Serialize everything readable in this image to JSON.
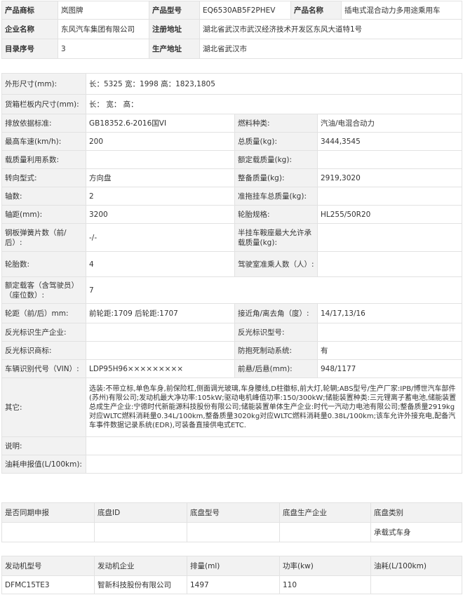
{
  "header": {
    "brand_label": "产品商标",
    "brand": "岚图牌",
    "model_label": "产品型号",
    "model": "EQ6530AB5F2PHEV",
    "name_label": "产品名称",
    "name": "插电式混合动力多用途乘用车",
    "company_label": "企业名称",
    "company": "东风汽车集团有限公司",
    "reg_addr_label": "注册地址",
    "reg_addr": "湖北省武汉市武汉经济技术开发区东风大道特1号",
    "catalog_label": "目录序号",
    "catalog": "3",
    "prod_addr_label": "生产地址",
    "prod_addr": "湖北省武汉市"
  },
  "specs": {
    "dims_label": "外形尺寸(mm):",
    "dims": "长：5325 宽：1998 高：1823,1805",
    "cargo_label": "货箱栏板内尺寸(mm):",
    "cargo": "长：  宽：  高：",
    "emission_label": "排放依据标准:",
    "emission": "GB18352.6-2016国VI",
    "fuel_label": "燃料种类:",
    "fuel": "汽油/电混合动力",
    "speed_label": "最高车速(km/h):",
    "speed": "200",
    "total_mass_label": "总质量(kg):",
    "total_mass": "3444,3545",
    "load_util_label": "载质量利用系数:",
    "load_util": "",
    "rated_load_label": "额定载质量(kg):",
    "rated_load": "",
    "steering_label": "转向型式:",
    "steering": "方向盘",
    "curb_label": "整备质量(kg):",
    "curb": "2919,3020",
    "axles_label": "轴数:",
    "axles": "2",
    "trailer_label": "准拖挂车总质量(kg):",
    "trailer": "",
    "wheelbase_label": "轴距(mm):",
    "wheelbase": "3200",
    "tire_label": "轮胎规格:",
    "tire": "HL255/50R20",
    "springs_label": "钢板弹簧片数（前/后）:",
    "springs": "-/-",
    "saddle_label": "半挂车鞍座最大允许承载质量(kg):",
    "saddle": "",
    "tires_num_label": "轮胎数:",
    "tires_num": "4",
    "cab_label": "驾驶室准乘人数（人）:",
    "cab": "",
    "seats_label": "额定载客（含驾驶员）（座位数）:",
    "seats": "7",
    "track_label": "轮距（前/后）mm:",
    "track": "前轮距:1709 后轮距:1707",
    "angle_label": "接近角/离去角（度）:",
    "angle": "14/17,13/16",
    "reflect_mfr_label": "反光标识生产企业:",
    "reflect_mfr": "",
    "reflect_model_label": "反光标识型号:",
    "reflect_model": "",
    "reflect_brand_label": "反光标识商标:",
    "reflect_brand": "",
    "abs_label": "防抱死制动系统:",
    "abs": "有",
    "vin_label": "车辆识别代号（VIN）:",
    "vin": "LDP95H96×××××××××",
    "overhang_label": "前悬/后悬(mm):",
    "overhang": "948/1177",
    "other_label": "其它:",
    "other": "选装:不带立标,单色车身,前保险杠,侧面调光玻璃,车身腰线,D柱徽标,前大灯,轮辋;ABS型号/生产厂家:IPB/博世汽车部件(苏州)有限公司;发动机最大净功率:105kW;驱动电机峰值功率:150/300kW;储能装置种类:三元锂离子蓄电池,储能装置总成生产企业:宁德时代新能源科技股份有限公司;储能装置单体生产企业:时代一汽动力电池有限公司;整备质量2919kg对应WLTC燃料消耗量0.34L/100km,整备质量3020kg对应WLTC燃料消耗量0.38L/100km;该车允许外接充电,配备汽车事件数据记录系统(EDR),可装备直接供电式ETC.",
    "note_label": "说明:",
    "note": "",
    "fuel_report_label": "油耗申报值(L/100km):",
    "fuel_report": ""
  },
  "chassis": {
    "headers": [
      "是否同期申报",
      "底盘ID",
      "底盘型号",
      "底盘生产企业",
      "底盘类别"
    ],
    "row": [
      "",
      "",
      "",
      "",
      "承载式车身"
    ]
  },
  "engine": {
    "headers": [
      "发动机型号",
      "发动机企业",
      "排量(ml)",
      "功率(kw)",
      "油耗(L/100km)"
    ],
    "row": [
      "DFMC15TE3",
      "智新科技股份有限公司",
      "1497",
      "110",
      ""
    ]
  }
}
